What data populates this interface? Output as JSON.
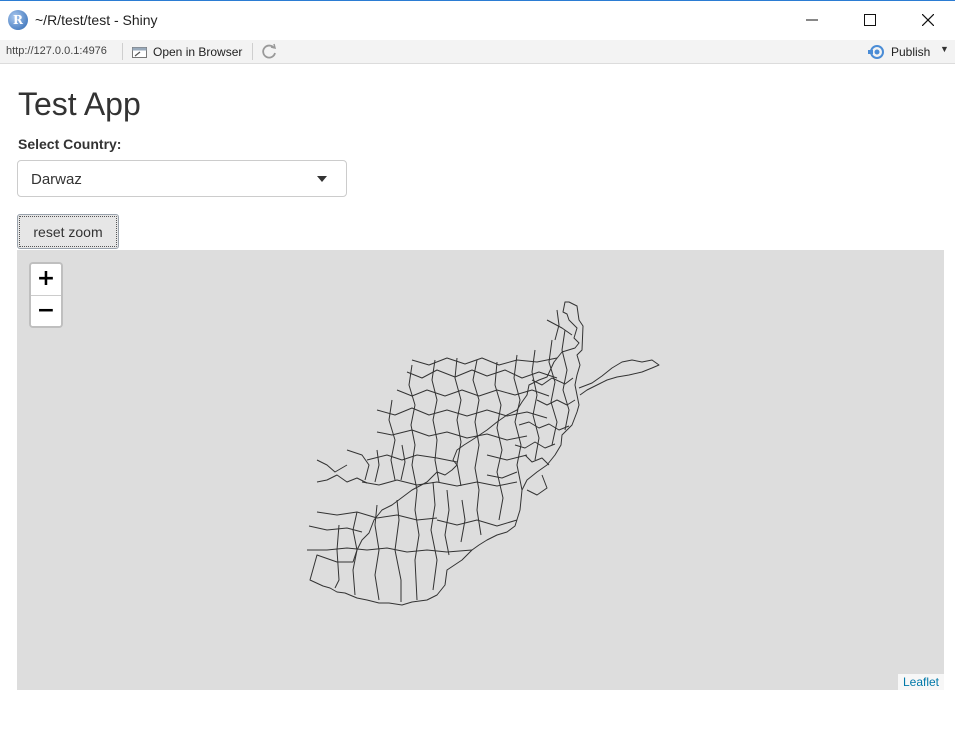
{
  "window": {
    "title": "~/R/test/test - Shiny",
    "icon_letter": "R"
  },
  "toolbar": {
    "url": "http://127.0.0.1:4976",
    "open_in_browser": "Open in Browser",
    "publish": "Publish"
  },
  "page": {
    "title": "Test App",
    "select_label": "Select Country:",
    "select_value": "Darwaz",
    "reset_button": "reset zoom"
  },
  "map": {
    "zoom_in": "+",
    "zoom_out": "−",
    "attribution": "Leaflet",
    "background_color": "#dddddd",
    "boundary_color": "#333333"
  }
}
